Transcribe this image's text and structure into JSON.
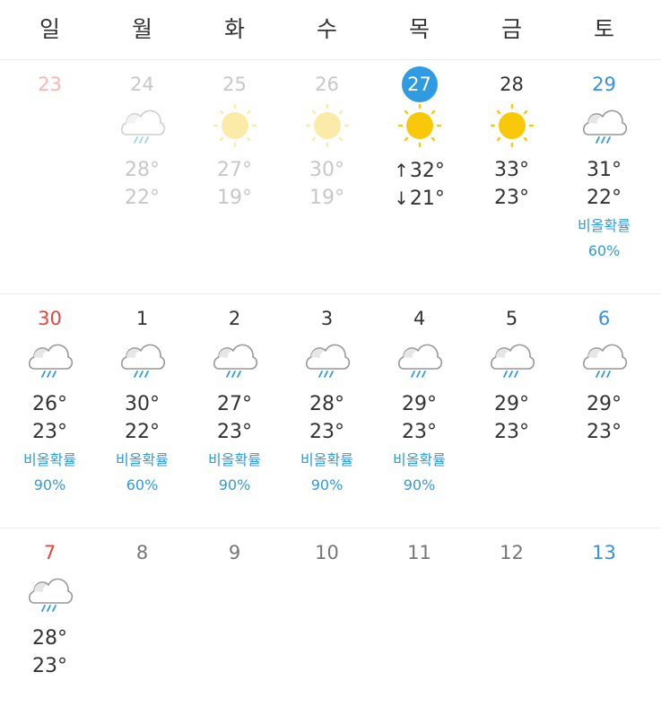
{
  "weekdays": [
    "일",
    "월",
    "화",
    "수",
    "목",
    "금",
    "토"
  ],
  "rain_label": "비올확률",
  "today": "27",
  "colors": {
    "accent": "#2f9be0",
    "sunday": "#e8433d",
    "saturday": "#3b8ee0",
    "sun": "#f9c808",
    "cloud_stroke": "#999999",
    "rain": "#2f9be0"
  },
  "weeks": [
    {
      "days": [
        {
          "date": "23",
          "icon": null,
          "high": "",
          "low": "",
          "rain": ""
        },
        {
          "date": "24",
          "icon": "rain-cloud-icon",
          "high": "28°",
          "low": "22°",
          "rain": ""
        },
        {
          "date": "25",
          "icon": "sun-icon",
          "high": "27°",
          "low": "19°",
          "rain": ""
        },
        {
          "date": "26",
          "icon": "sun-icon",
          "high": "30°",
          "low": "19°",
          "rain": ""
        },
        {
          "date": "27",
          "icon": "sun-icon",
          "high": "32°",
          "low": "21°",
          "rain": "",
          "high_arrow": "↑",
          "low_arrow": "↓"
        },
        {
          "date": "28",
          "icon": "sun-icon",
          "high": "33°",
          "low": "23°",
          "rain": ""
        },
        {
          "date": "29",
          "icon": "rain-cloud-icon",
          "high": "31°",
          "low": "22°",
          "rain": "60%"
        }
      ]
    },
    {
      "days": [
        {
          "date": "30",
          "icon": "rain-cloud-icon",
          "high": "26°",
          "low": "23°",
          "rain": "90%"
        },
        {
          "date": "1",
          "icon": "rain-cloud-icon",
          "high": "30°",
          "low": "22°",
          "rain": "60%"
        },
        {
          "date": "2",
          "icon": "rain-cloud-icon",
          "high": "27°",
          "low": "23°",
          "rain": "90%"
        },
        {
          "date": "3",
          "icon": "rain-cloud-icon",
          "high": "28°",
          "low": "23°",
          "rain": "90%"
        },
        {
          "date": "4",
          "icon": "rain-cloud-icon",
          "high": "29°",
          "low": "23°",
          "rain": "90%"
        },
        {
          "date": "5",
          "icon": "rain-cloud-icon",
          "high": "29°",
          "low": "23°",
          "rain": ""
        },
        {
          "date": "6",
          "icon": "rain-cloud-icon",
          "high": "29°",
          "low": "23°",
          "rain": ""
        }
      ]
    },
    {
      "days": [
        {
          "date": "7",
          "icon": "rain-cloud-icon",
          "high": "28°",
          "low": "23°",
          "rain": ""
        },
        {
          "date": "8",
          "icon": null,
          "high": "",
          "low": "",
          "rain": ""
        },
        {
          "date": "9",
          "icon": null,
          "high": "",
          "low": "",
          "rain": ""
        },
        {
          "date": "10",
          "icon": null,
          "high": "",
          "low": "",
          "rain": ""
        },
        {
          "date": "11",
          "icon": null,
          "high": "",
          "low": "",
          "rain": ""
        },
        {
          "date": "12",
          "icon": null,
          "high": "",
          "low": "",
          "rain": ""
        },
        {
          "date": "13",
          "icon": null,
          "high": "",
          "low": "",
          "rain": ""
        }
      ]
    }
  ]
}
